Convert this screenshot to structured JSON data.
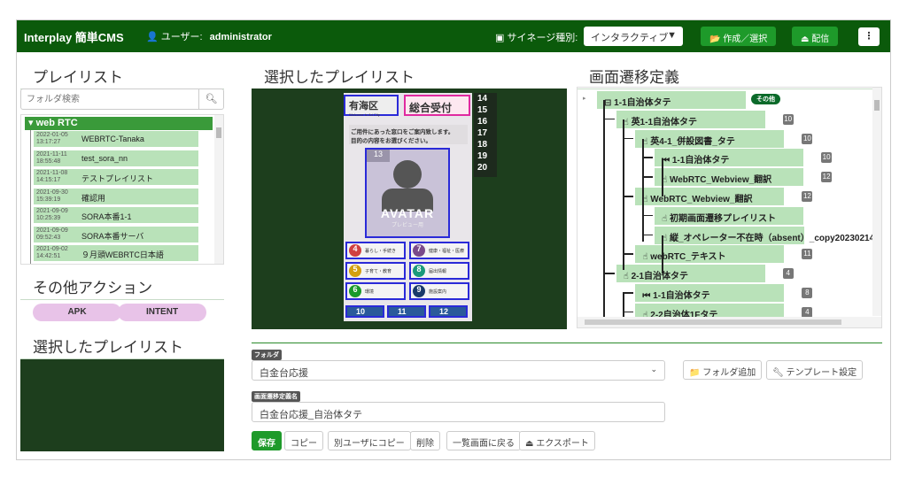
{
  "header": {
    "brand": "Interplay 簡単CMS",
    "user_label": "ユーザー:",
    "user_name": "administrator",
    "signage_label": "サイネージ種別:",
    "signage_value": "インタラクティブ",
    "create_button": "作成／選択",
    "deliver_button": "配信",
    "menu_icon": "kebab-icon"
  },
  "playlist": {
    "title": "プレイリスト",
    "search_placeholder": "フォルダ検索",
    "folder": "web RTC",
    "items": [
      {
        "date": "2022-01-05",
        "time": "13:17:27",
        "name": "WEBRTC-Tanaka"
      },
      {
        "date": "2021-11-11",
        "time": "18:55:48",
        "name": "test_sora_nn"
      },
      {
        "date": "2021-11-08",
        "time": "14:15:17",
        "name": "テストプレイリスト"
      },
      {
        "date": "2021-09-30",
        "time": "15:39:19",
        "name": "確認用"
      },
      {
        "date": "2021-09-09",
        "time": "10:25:39",
        "name": "SORA本番1-1"
      },
      {
        "date": "2021-09-09",
        "time": "09:52:43",
        "name": "SORA本番サーバ"
      },
      {
        "date": "2021-09-02",
        "time": "14:42:51",
        "name": "９月頭WEBRTC日本語"
      }
    ]
  },
  "other_actions": {
    "title": "その他アクション",
    "apk": "APK",
    "intent": "INTENT"
  },
  "selected_left": {
    "title": "選択したプレイリスト"
  },
  "preview": {
    "title": "選択したプレイリスト",
    "region_label": "有海区",
    "region_sub": "Welcome to Ari City",
    "reception": "総合受付",
    "guide_text": "ご用件にあった窓口をご案内致します。\n目的の内容をお選びください。",
    "avatar": "AVATAR",
    "avatar_sub": "プレビュー用",
    "side_numbers": [
      "14",
      "15",
      "16",
      "17",
      "18",
      "19",
      "20"
    ],
    "buttons": [
      {
        "n": "4",
        "label": "暮らし・手続き",
        "color": "#d04040"
      },
      {
        "n": "7",
        "label": "健康・福祉・医療",
        "color": "#7a4a8a"
      },
      {
        "n": "5",
        "label": "子育て・教育",
        "color": "#d4a010"
      },
      {
        "n": "8",
        "label": "届出情報",
        "color": "#1a9a7a"
      },
      {
        "n": "6",
        "label": "環境",
        "color": "#1a9a2a"
      },
      {
        "n": "9",
        "label": "施設案内",
        "color": "#1a3a6a"
      }
    ],
    "bottom": [
      "10",
      "11",
      "12"
    ],
    "num1": "1",
    "num2": "2",
    "num3": "3",
    "num13": "13"
  },
  "transition": {
    "title": "画面遷移定義",
    "other_badge": "その他",
    "nodes": [
      {
        "level": 0,
        "icon": "save-icon",
        "label": "1-1自治体タテ",
        "badge": ""
      },
      {
        "level": 1,
        "icon": "hand-pointer-icon",
        "label": "英1-1自治体タテ",
        "badge": "10"
      },
      {
        "level": 2,
        "icon": "hand-pointer-icon",
        "label": "英4-1_併設図書_タテ",
        "badge": "10"
      },
      {
        "level": 3,
        "icon": "skip-back-icon",
        "label": "1-1自治体タテ",
        "badge": "10"
      },
      {
        "level": 3,
        "icon": "hand-pointer-icon",
        "label": "WebRTC_Webview_翻訳",
        "badge": "12"
      },
      {
        "level": 2,
        "icon": "hand-pointer-icon",
        "label": "WebRTC_Webview_翻訳",
        "badge": "12"
      },
      {
        "level": 3,
        "icon": "hand-pointer-icon",
        "label": "初期画面遷移プレイリスト",
        "badge": ""
      },
      {
        "level": 3,
        "icon": "hand-pointer-icon",
        "label": "縦_オペレーター不在時（absent）_copy20230214",
        "badge": ""
      },
      {
        "level": 2,
        "icon": "hand-pointer-icon",
        "label": "webRTC_テキスト",
        "badge": "11"
      },
      {
        "level": 1,
        "icon": "hand-pointer-icon",
        "label": "2-1自治体タテ",
        "badge": "4"
      },
      {
        "level": 2,
        "icon": "skip-back-icon",
        "label": "1-1自治体タテ",
        "badge": "8"
      },
      {
        "level": 2,
        "icon": "hand-pointer-icon",
        "label": "2-2自治体1Fタテ",
        "badge": "4"
      }
    ]
  },
  "form": {
    "folder_label": "フォルダ",
    "folder_value": "白金台応援",
    "add_folder": "フォルダ追加",
    "template_settings": "テンプレート設定",
    "name_label": "画面遷移定義名",
    "name_value": "白金台応援_自治体タテ",
    "buttons": {
      "save": "保存",
      "copy": "コピー",
      "copy_other": "別ユーザにコピー",
      "delete": "削除",
      "back": "一覧画面に戻る",
      "export": "エクスポート"
    }
  },
  "colors": {
    "header": "#0b5a0b",
    "accent": "#1e9a2a",
    "node": "#b9e2b9",
    "pill": "#e8c3e8"
  }
}
